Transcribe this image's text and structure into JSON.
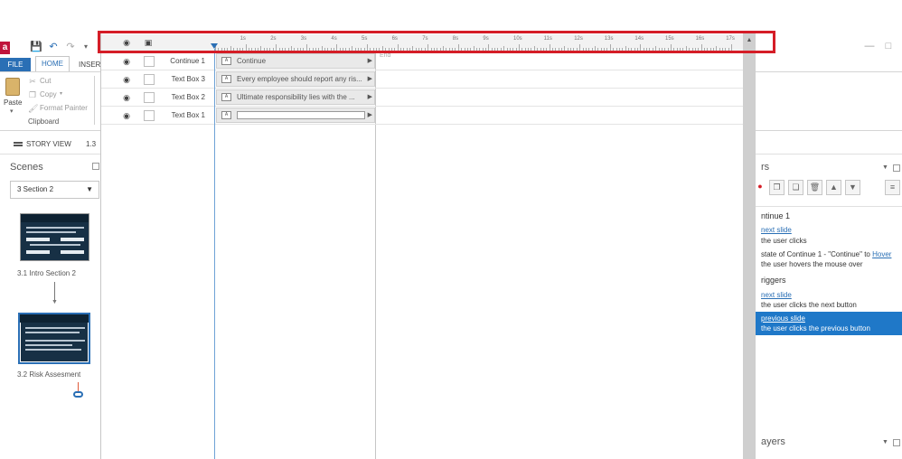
{
  "ribbon": {
    "tabs": {
      "file": "FILE",
      "home": "HOME",
      "insert": "INSERT"
    },
    "paste_label": "Paste",
    "cut_label": "Cut",
    "copy_label": "Copy",
    "format_painter_label": "Format Painter",
    "clipboard_group": "Clipboard"
  },
  "views": {
    "story_view": "STORY VIEW",
    "slide_tab": "1.3"
  },
  "scenes": {
    "title": "Scenes",
    "selected_scene": "3 Section 2",
    "slides": [
      {
        "label": "3.1 Intro Section 2"
      },
      {
        "label": "3.2 Risk Assesment"
      }
    ]
  },
  "timeline": {
    "ruler_labels": [
      "1s",
      "2s",
      "3s",
      "4s",
      "5s",
      "6s",
      "7s",
      "8s",
      "9s",
      "10s",
      "11s",
      "12s",
      "13s",
      "14s",
      "15s",
      "16s",
      "17s"
    ],
    "end_label": "End",
    "rows": [
      {
        "name": "Continue 1",
        "bar_text": "Continue"
      },
      {
        "name": "Text Box 3",
        "bar_text": "Every employee should report any ris..."
      },
      {
        "name": "Text Box 2",
        "bar_text": "Ultimate responsibility lies with the ..."
      },
      {
        "name": "Text Box 1",
        "bar_text": ""
      }
    ]
  },
  "triggers": {
    "header": "rs",
    "object_heading": "ntinue 1",
    "t1_action": "next slide",
    "t1_when": "the user clicks",
    "t2_prefix": "state of Continue 1 - \"Continue\" to ",
    "t2_link": "Hover",
    "t2_when": "the user hovers the mouse over",
    "player_heading": "riggers",
    "t3_action": "next slide",
    "t3_when": "the user clicks the next button",
    "t4_action": "previous slide",
    "t4_when": "the user clicks the previous button",
    "layers_label": "ayers"
  },
  "colors": {
    "accent": "#2a6fb5",
    "highlight": "#d51d27",
    "selected_row": "#1f78c8"
  }
}
